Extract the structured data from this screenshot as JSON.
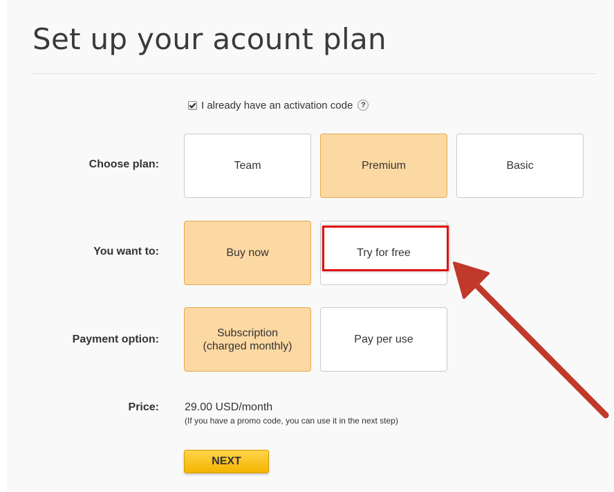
{
  "page": {
    "title": "Set up your acount plan"
  },
  "activation": {
    "checked": true,
    "label": "I already have an activation code",
    "help_glyph": "?"
  },
  "plan": {
    "label": "Choose plan:",
    "options": [
      "Team",
      "Premium",
      "Basic"
    ],
    "selected": "Premium"
  },
  "intent": {
    "label": "You want to:",
    "options": [
      "Buy now",
      "Try for free"
    ],
    "selected": "Buy now"
  },
  "payment": {
    "label": "Payment option:",
    "options": [
      {
        "line1": "Subscription",
        "line2": "(charged monthly)"
      },
      {
        "line1": "Pay per use",
        "line2": ""
      }
    ],
    "selected": "Subscription"
  },
  "price": {
    "label": "Price:",
    "value": "29.00 USD/month",
    "note": "(If you have a promo code, you can use it in the next step)"
  },
  "next_label": "NEXT",
  "annotation": {
    "highlight_color": "#e01010",
    "arrow_color": "#c0392b",
    "highlights": "Try for free"
  },
  "colors": {
    "selected_fill": "#fcd9a2",
    "selected_border": "#e4a84f",
    "button_fill": "#f4b300"
  }
}
